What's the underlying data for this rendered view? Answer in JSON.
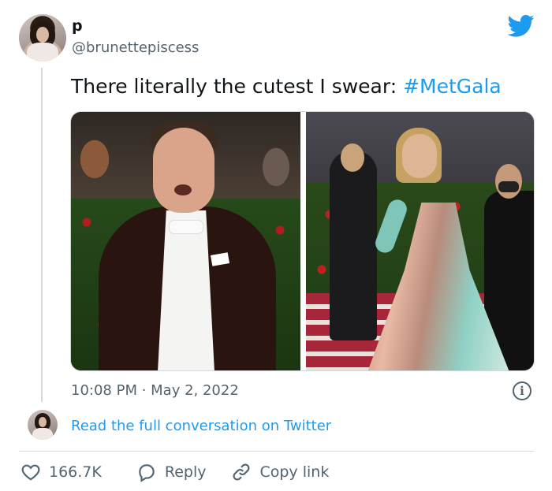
{
  "author": {
    "name": "p",
    "handle": "@brunettepiscess"
  },
  "tweet": {
    "text": "There literally the cutest I swear: ",
    "hashtag": "#MetGala"
  },
  "meta": {
    "timestamp": "10:08 PM · May 2, 2022",
    "info_symbol": "i"
  },
  "conversation": {
    "link_label": "Read the full conversation on Twitter"
  },
  "actions": {
    "likes": "166.7K",
    "reply": "Reply",
    "copy_link": "Copy link"
  },
  "colors": {
    "accent": "#1d9bf0",
    "muted": "#536471",
    "text": "#0f1419",
    "border": "#cfd9de"
  },
  "icons": [
    "avatar",
    "twitter-bird-icon",
    "info-icon",
    "heart-icon",
    "reply-bubble-icon",
    "link-icon"
  ]
}
